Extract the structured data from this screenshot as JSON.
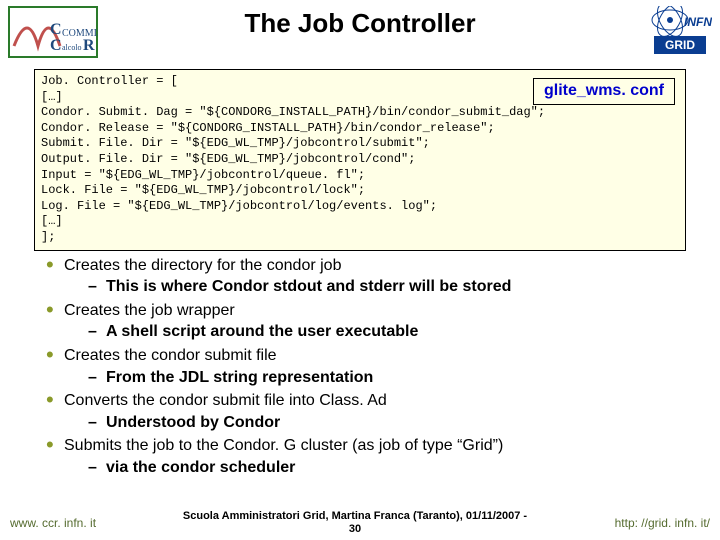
{
  "header": {
    "title": "The Job Controller"
  },
  "code": {
    "conf_label": "glite_wms. conf",
    "lines": [
      "Job. Controller = [",
      "[…]",
      "Condor. Submit. Dag = \"${CONDORG_INSTALL_PATH}/bin/condor_submit_dag\";",
      "Condor. Release = \"${CONDORG_INSTALL_PATH}/bin/condor_release\";",
      "Submit. File. Dir = \"${EDG_WL_TMP}/jobcontrol/submit\";",
      "Output. File. Dir = \"${EDG_WL_TMP}/jobcontrol/cond\";",
      "Input = \"${EDG_WL_TMP}/jobcontrol/queue. fl\";",
      "Lock. File = \"${EDG_WL_TMP}/jobcontrol/lock\";",
      "Log. File = \"${EDG_WL_TMP}/jobcontrol/log/events. log\";",
      "[…]",
      "];"
    ]
  },
  "bullets": [
    {
      "text": "Creates the directory for the condor job",
      "sub": "This is where Condor stdout and stderr will be stored"
    },
    {
      "text": "Creates the job wrapper",
      "sub": "A shell script around the user executable"
    },
    {
      "text": "Creates the condor submit file",
      "sub": "From the JDL string representation"
    },
    {
      "text": "Converts the condor submit file into Class. Ad",
      "sub": "Understood by Condor"
    },
    {
      "text": "Submits the job to the Condor. G cluster (as job of type “Grid”)",
      "sub": "via the condor scheduler"
    }
  ],
  "footer": {
    "left": "www. ccr. infn. it",
    "center_l1": "Scuola Amministratori Grid, Martina Franca (Taranto), 01/11/2007 -",
    "center_l2": "30",
    "right": "http: //grid. infn. it/"
  }
}
